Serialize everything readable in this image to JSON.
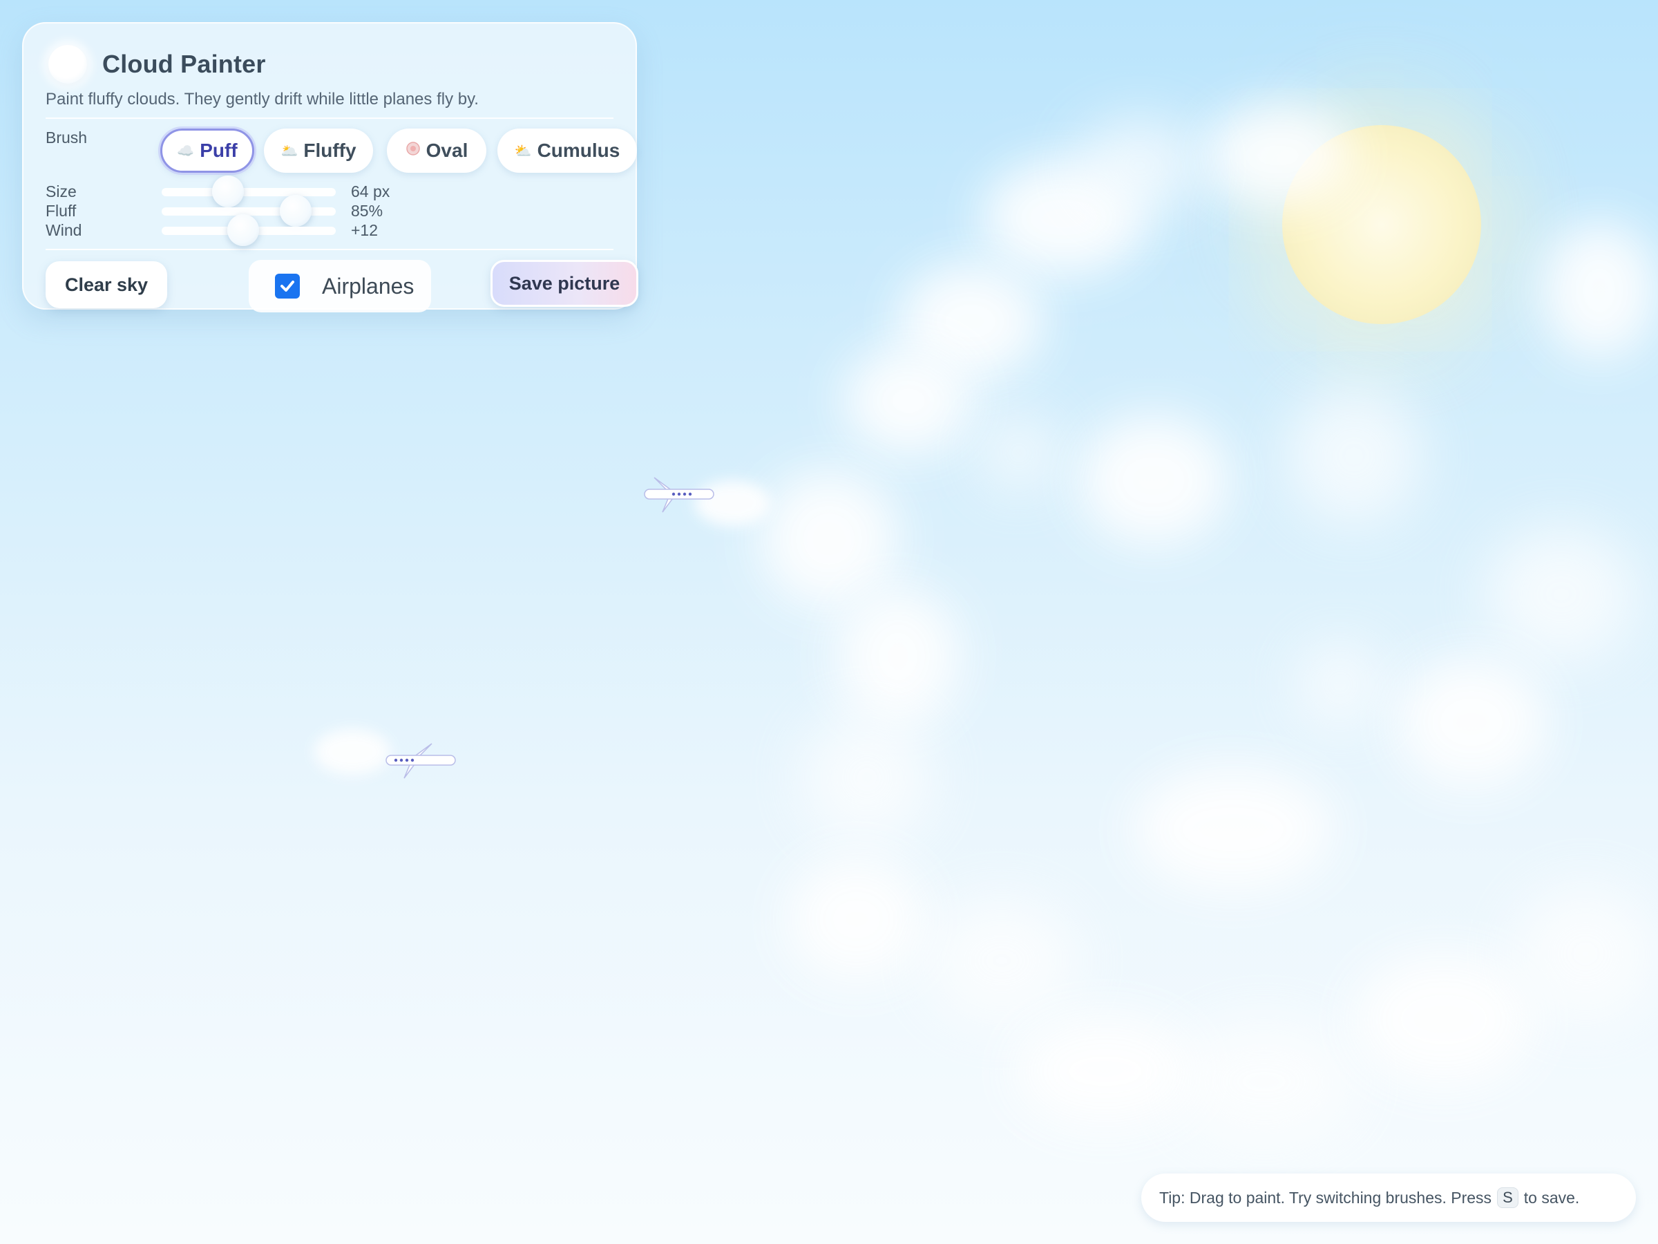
{
  "app": {
    "title": "Cloud Painter",
    "subtitle": "Paint fluffy clouds. They gently drift while little planes fly by."
  },
  "brush": {
    "label": "Brush",
    "selected": "Puff",
    "options": [
      {
        "label": "Puff",
        "icon": "cloud-icon"
      },
      {
        "label": "Fluffy",
        "icon": "sun-cloud-icon"
      },
      {
        "label": "Oval",
        "icon": "oval-icon"
      },
      {
        "label": "Cumulus",
        "icon": "sun-behind-cloud-icon"
      }
    ]
  },
  "sliders": {
    "size": {
      "label": "Size",
      "value": 64,
      "display": "64 px",
      "fraction": 0.38
    },
    "fluff": {
      "label": "Fluff",
      "value": 85,
      "display": "85%",
      "fraction": 0.77
    },
    "wind": {
      "label": "Wind",
      "value": 12,
      "display": "+12",
      "fraction": 0.47
    }
  },
  "actions": {
    "clear_label": "Clear sky",
    "airplanes_label": "Airplanes",
    "airplanes_checked": true,
    "save_label": "Save picture"
  },
  "tip": {
    "prefix": "Tip: Drag to paint. Try switching brushes. Press",
    "key": "S",
    "suffix": "to save."
  },
  "colors": {
    "accent": "#8f94e6",
    "checkbox": "#1a74f0",
    "sky_top": "#b9e4fc",
    "sky_bottom": "#f8fcfe",
    "sun": "#fbf4c8"
  }
}
